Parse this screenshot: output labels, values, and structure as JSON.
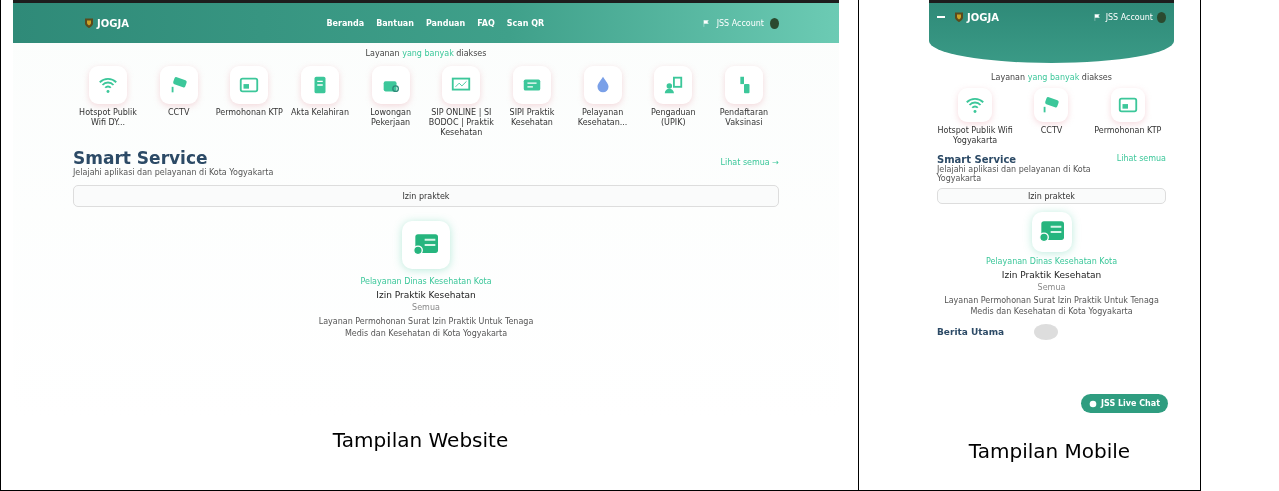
{
  "website": {
    "logo": "JOGJA",
    "nav": [
      "Beranda",
      "Bantuan",
      "Panduan",
      "FAQ",
      "Scan QR"
    ],
    "account": "JSS Account",
    "popular_heading": [
      {
        "text": "Layanan ",
        "highlight": false
      },
      {
        "text": "yang banyak",
        "highlight": true
      },
      {
        "text": " diakses",
        "highlight": false
      }
    ],
    "services": [
      {
        "label": "Hotspot Publik Wifi DY..."
      },
      {
        "label": "CCTV"
      },
      {
        "label": "Permohonan KTP"
      },
      {
        "label": "Akta Kelahiran"
      },
      {
        "label": "Lowongan Pekerjaan"
      },
      {
        "label": "SIP ONLINE | SI BODOC | Praktik Kesehatan"
      },
      {
        "label": "SIPI Praktik Kesehatan"
      },
      {
        "label": "Pelayanan Kesehatan..."
      },
      {
        "label": "Pengaduan (UPIK)"
      },
      {
        "label": "Pendaftaran Vaksinasi"
      }
    ],
    "section": {
      "title": "Smart Service",
      "subtitle": "Jelajahi aplikasi dan pelayanan di Kota Yogyakarta",
      "link": "Lihat semua →"
    },
    "search": {
      "placeholder": "Izin praktek"
    },
    "result": {
      "category": "Pelayanan Dinas Kesehatan Kota",
      "title": "Izin Praktik Kesehatan",
      "meta": "Semua",
      "description": "Layanan Permohonan Surat Izin Praktik Untuk Tenaga Medis dan Kesehatan di Kota Yogyakarta"
    },
    "caption": "Tampilan Website"
  },
  "mobile": {
    "logo": "JOGJA",
    "account": "JSS Account",
    "popular_heading": [
      {
        "text": "Layanan ",
        "highlight": false
      },
      {
        "text": "yang banyak",
        "highlight": true
      },
      {
        "text": " diakses",
        "highlight": false
      }
    ],
    "services": [
      {
        "label": "Hotspot Publik Wifi Yogyakarta"
      },
      {
        "label": "CCTV"
      },
      {
        "label": "Permohonan KTP"
      }
    ],
    "section": {
      "title": "Smart Service",
      "subtitle": "Jelajahi aplikasi dan pelayanan di Kota Yogyakarta",
      "link": "Lihat semua"
    },
    "search": {
      "placeholder": "Izin praktek"
    },
    "result": {
      "category": "Pelayanan Dinas Kesehatan Kota",
      "title": "Izin Praktik Kesehatan",
      "meta": "Semua",
      "description": "Layanan Permohonan Surat Izin Praktik Untuk Tenaga Medis dan Kesehatan di Kota Yogyakarta"
    },
    "news_title": "Berita Utama",
    "chat_button": "JSS Live Chat",
    "caption": "Tampilan Mobile"
  }
}
